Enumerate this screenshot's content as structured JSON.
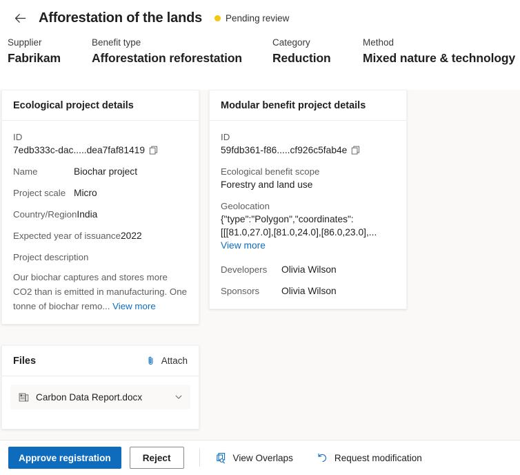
{
  "header": {
    "back_icon": "arrow-left-icon",
    "title": "Afforestation of the lands",
    "status_label": "Pending review",
    "status_color": "#f2c811",
    "meta": [
      {
        "label": "Supplier",
        "value": "Fabrikam"
      },
      {
        "label": "Benefit type",
        "value": "Afforestation reforestation"
      },
      {
        "label": "Category",
        "value": "Reduction"
      },
      {
        "label": "Method",
        "value": "Mixed nature & technology"
      }
    ]
  },
  "ecological_card": {
    "title": "Ecological project details",
    "id_label": "ID",
    "id_value": "7edb333c-dac.....dea7faf81419",
    "copy_icon": "copy-icon",
    "fields": [
      {
        "label": "Name",
        "value": "Biochar project"
      },
      {
        "label": "Project scale",
        "value": "Micro"
      },
      {
        "label": "Country/Region",
        "value": "India"
      },
      {
        "label": "Expected year of issuance",
        "value": "2022"
      }
    ],
    "description_label": "Project description",
    "description": "Our biochar captures and stores more CO2 than is emitted in manufacturing. One tonne of biochar remo...",
    "view_more": "View more"
  },
  "modular_card": {
    "title": "Modular benefit project details",
    "id_label": "ID",
    "id_value": "59fdb361-f86.....cf926c5fab4e",
    "copy_icon": "copy-icon",
    "scope_label": "Ecological benefit scope",
    "scope_value": "Forestry and land use",
    "geo_label": "Geolocation",
    "geo_value": "{\"type\":\"Polygon\",\"coordinates\": [[[81.0,27.0],[81.0,24.0],[86.0,23.0],...",
    "view_more": "View more",
    "fields": [
      {
        "label": "Developers",
        "value": "Olivia Wilson"
      },
      {
        "label": "Sponsors",
        "value": "Olivia Wilson"
      }
    ]
  },
  "files_card": {
    "title": "Files",
    "attach_label": "Attach",
    "attach_icon": "paperclip-icon",
    "file": {
      "icon": "word-document-icon",
      "name": "Carbon Data Report.docx",
      "expand_icon": "chevron-down-icon"
    }
  },
  "footer": {
    "approve_label": "Approve registration",
    "reject_label": "Reject",
    "view_overlaps_label": "View Overlaps",
    "view_overlaps_icon": "copy-search-icon",
    "request_modification_label": "Request modification",
    "request_modification_icon": "undo-arrow-icon",
    "accent_color": "#0f6cbd"
  }
}
